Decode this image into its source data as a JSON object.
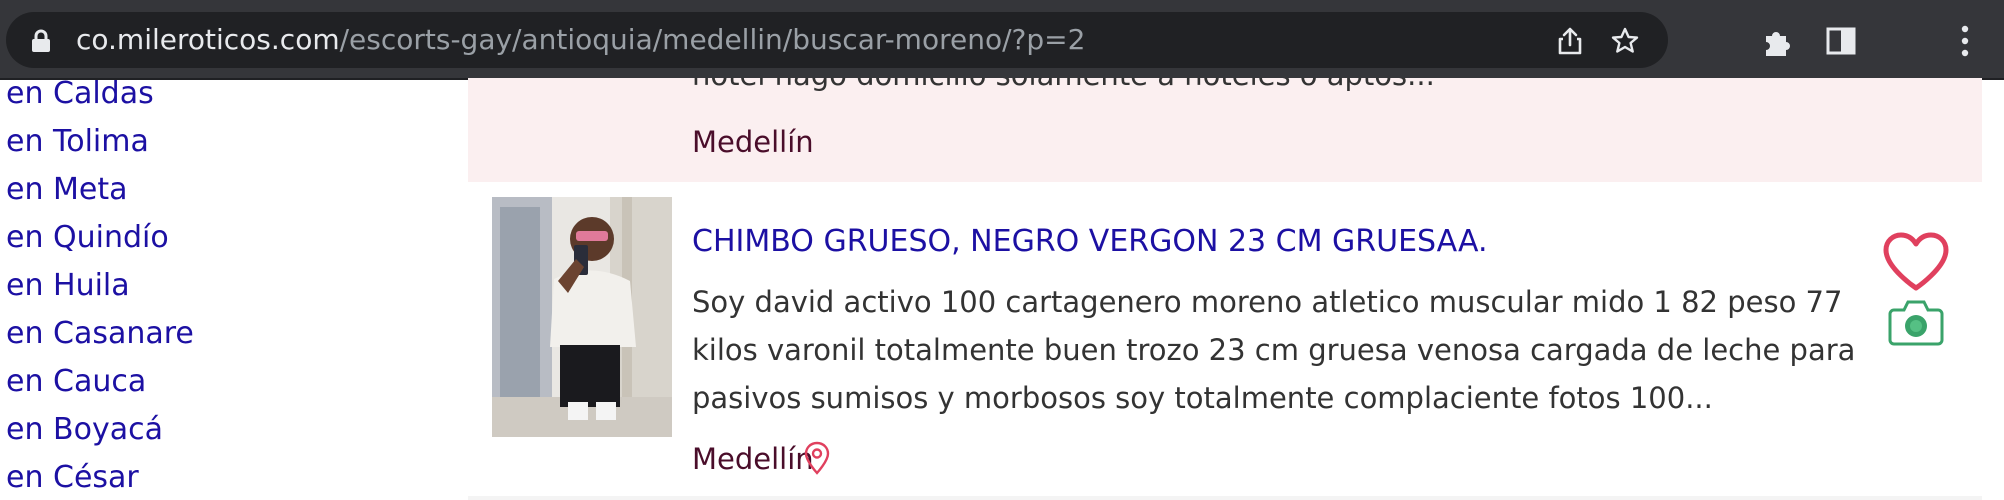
{
  "browser": {
    "url_host": "co.mileroticos.com",
    "url_path": "/escorts-gay/antioquia/medellin/buscar-moreno/?p=2",
    "icons": [
      "lock-icon",
      "share-icon",
      "bookmark-star-icon",
      "extensions-puzzle-icon",
      "side-panel-icon",
      "menu-kebab-icon"
    ]
  },
  "sidebar": {
    "items": [
      {
        "label": "en Caldas"
      },
      {
        "label": "en Tolima"
      },
      {
        "label": "en Meta"
      },
      {
        "label": "en Quindío"
      },
      {
        "label": "en Huila"
      },
      {
        "label": "en Casanare"
      },
      {
        "label": "en Cauca"
      },
      {
        "label": "en Boyacá"
      },
      {
        "label": "en César"
      }
    ]
  },
  "listings": [
    {
      "description_tail": "hotel hago domicilio solamente a hoteles o aptos...",
      "city": "Medellín"
    },
    {
      "title": "CHIMBO GRUESO, NEGRO VERGON 23 CM GRUESAA.",
      "description": "Soy david activo 100 cartagenero moreno atletico muscular mido 1 82 peso 77 kilos varonil totalmente buen trozo 23 cm gruesa venosa cargada de leche para pasivos sumisos y morbosos soy totalmente complaciente fotos 100...",
      "city": "Medellín",
      "icons": [
        "location-pin-icon",
        "favorite-heart-icon",
        "photos-camera-icon"
      ]
    }
  ],
  "colors": {
    "toolbar_bg": "#35363a",
    "omnibox_bg": "#202124",
    "link_blue": "#1c10a3",
    "city_maroon": "#4a0d2a",
    "highlight_pink": "#fbeff0",
    "heart_pink": "#e0405e",
    "camera_green": "#3aa36a"
  }
}
